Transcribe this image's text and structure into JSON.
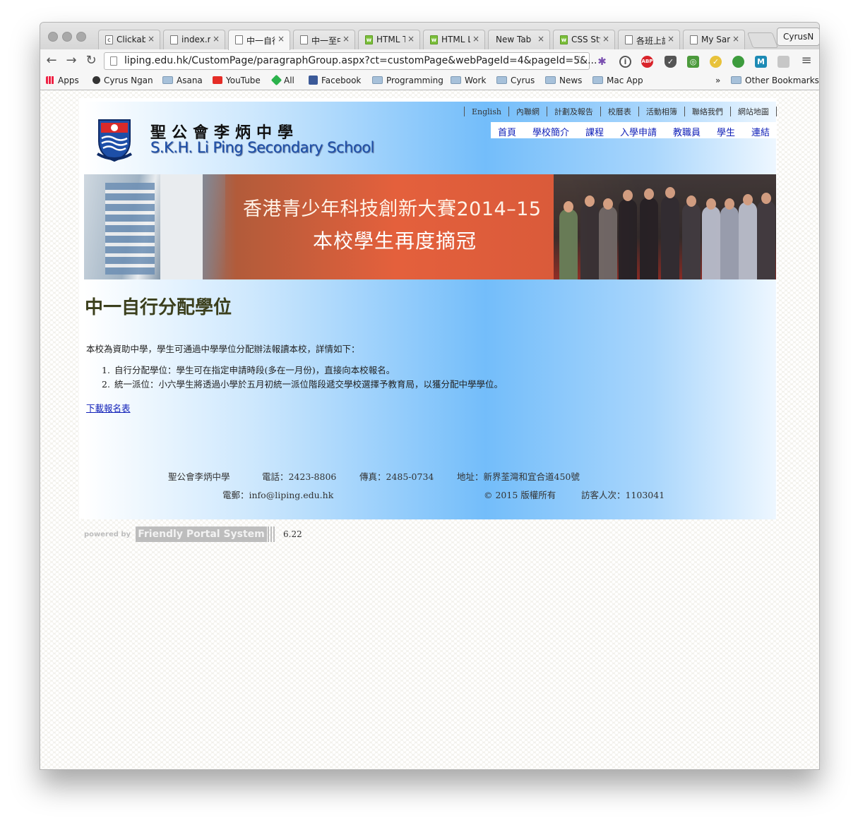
{
  "browser": {
    "tabs": [
      {
        "title": "Clickable",
        "icon": "c",
        "active": false
      },
      {
        "title": "index.m",
        "icon": "",
        "active": false
      },
      {
        "title": "中一自行",
        "icon": "",
        "active": true
      },
      {
        "title": "中一至中",
        "icon": "",
        "active": false
      },
      {
        "title": "HTML T",
        "icon": "w3",
        "active": false
      },
      {
        "title": "HTML L",
        "icon": "w3",
        "active": false
      },
      {
        "title": "New Tab",
        "icon": "",
        "active": false
      },
      {
        "title": "CSS Sty",
        "icon": "w3",
        "active": false
      },
      {
        "title": "各班上課",
        "icon": "",
        "active": false
      },
      {
        "title": "My Sand",
        "icon": "",
        "active": false
      }
    ],
    "tab_close": "×",
    "profile": "CyrusN",
    "url": "liping.edu.hk/CustomPage/paragraphGroup.aspx?ct=customPage&webPageId=4&pageId=5&...",
    "bookmarks": [
      {
        "label": "Apps",
        "kind": "apps-icon"
      },
      {
        "label": "Cyrus Ngan",
        "kind": "page-icon"
      },
      {
        "label": "Asana",
        "kind": "folder-icon"
      },
      {
        "label": "YouTube",
        "kind": "youtube-icon"
      },
      {
        "label": "All",
        "kind": "feedly-icon"
      },
      {
        "label": "Facebook",
        "kind": "facebook-icon"
      },
      {
        "label": "Programming",
        "kind": "folder-icon"
      },
      {
        "label": "Work",
        "kind": "folder-icon"
      },
      {
        "label": "Cyrus",
        "kind": "folder-icon"
      },
      {
        "label": "News",
        "kind": "folder-icon"
      },
      {
        "label": "Mac App",
        "kind": "folder-icon"
      }
    ],
    "bookmarks_overflow": "»",
    "other_bookmarks": "Other Bookmarks"
  },
  "site": {
    "school_name_zh": "聖公會李炳中學",
    "school_name_en": "S.K.H. Li Ping Secondary School",
    "top_nav": [
      "English",
      "內聯網",
      "計劃及報告",
      "校曆表",
      "活動相簿",
      "聯絡我們",
      "網站地圖"
    ],
    "main_nav": [
      "首頁",
      "學校簡介",
      "課程",
      "入學申請",
      "教職員",
      "學生",
      "連結"
    ],
    "banner": {
      "line1": "香港青少年科技創新大賽2014–15",
      "line2": "本校學生再度摘冠"
    },
    "page_title": "中一自行分配學位",
    "intro": "本校為資助中學，學生可通過中學學位分配辦法報讀本校，詳情如下：",
    "list": [
      {
        "num": "1.",
        "text": "自行分配學位：學生可在指定申請時段(多在一月份)，直接向本校報名。"
      },
      {
        "num": "2.",
        "text": "統一派位：小六學生將透過小學於五月初統一派位階段遞交學校選擇予教育局，以獲分配中學學位。"
      }
    ],
    "download_link": "下載報名表",
    "footer": {
      "name": "聖公會李炳中學",
      "phone": "電話：2423-8806",
      "fax": "傳真：2485-0734",
      "address": "地址：新界荃灣和宜合道450號",
      "email": "電郵：info@liping.edu.hk",
      "copyright": "© 2015 版權所有",
      "visitors": "訪客人次：1103041"
    },
    "powered_by": "powered by",
    "portal": "Friendly Portal System",
    "version": "6.22"
  },
  "colors": {
    "link": "#1020b8",
    "title": "#3b3f1c",
    "gradient_mid": "#73bdfa"
  }
}
